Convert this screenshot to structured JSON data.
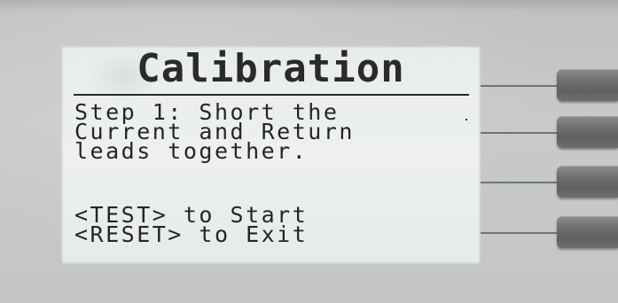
{
  "screen": {
    "title": "Calibration",
    "lines": [
      "Step 1: Short the",
      "Current and Return",
      "leads together.",
      "",
      "<TEST> to Start",
      "<RESET> to Exit"
    ]
  },
  "softkeys": [
    {
      "label": ""
    },
    {
      "label": ""
    },
    {
      "label": ""
    },
    {
      "label": ""
    }
  ]
}
